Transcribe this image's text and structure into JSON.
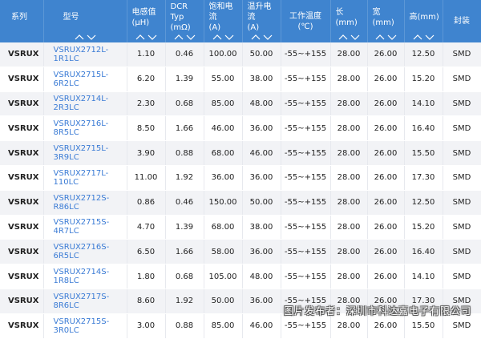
{
  "headers": {
    "series": "系列",
    "model": "型号",
    "inductance": "电感值\n(μH)",
    "dcr": "DCR Typ\n(mΩ)",
    "sat_current": "饱和电流\n(A)",
    "temp_current": "温升电流\n(A)",
    "op_temp": "工作温度\n(℃)",
    "length": "长(mm)",
    "width": "宽(mm)",
    "height": "高(mm)",
    "package": "封装"
  },
  "rows": [
    {
      "series": "VSRUX",
      "model": "VSRUX2712L-1R1LC",
      "inductance": "1.10",
      "dcr": "0.46",
      "sat": "100.00",
      "temp": "50.00",
      "op": "-55~+155",
      "l": "28.00",
      "w": "26.00",
      "h": "12.50",
      "pkg": "SMD"
    },
    {
      "series": "VSRUX",
      "model": "VSRUX2715L-6R2LC",
      "inductance": "6.20",
      "dcr": "1.39",
      "sat": "55.00",
      "temp": "38.00",
      "op": "-55~+155",
      "l": "28.00",
      "w": "26.00",
      "h": "15.20",
      "pkg": "SMD"
    },
    {
      "series": "VSRUX",
      "model": "VSRUX2714L-2R3LC",
      "inductance": "2.30",
      "dcr": "0.68",
      "sat": "85.00",
      "temp": "48.00",
      "op": "-55~+155",
      "l": "28.00",
      "w": "26.00",
      "h": "14.10",
      "pkg": "SMD"
    },
    {
      "series": "VSRUX",
      "model": "VSRUX2716L-8R5LC",
      "inductance": "8.50",
      "dcr": "1.66",
      "sat": "46.00",
      "temp": "36.00",
      "op": "-55~+155",
      "l": "28.00",
      "w": "26.00",
      "h": "16.40",
      "pkg": "SMD"
    },
    {
      "series": "VSRUX",
      "model": "VSRUX2715L-3R9LC",
      "inductance": "3.90",
      "dcr": "0.88",
      "sat": "68.00",
      "temp": "46.00",
      "op": "-55~+155",
      "l": "28.00",
      "w": "26.00",
      "h": "15.50",
      "pkg": "SMD"
    },
    {
      "series": "VSRUX",
      "model": "VSRUX2717L-110LC",
      "inductance": "11.00",
      "dcr": "1.92",
      "sat": "36.00",
      "temp": "36.00",
      "op": "-55~+155",
      "l": "28.00",
      "w": "26.00",
      "h": "17.30",
      "pkg": "SMD"
    },
    {
      "series": "VSRUX",
      "model": "VSRUX2712S-R86LC",
      "inductance": "0.86",
      "dcr": "0.46",
      "sat": "150.00",
      "temp": "50.00",
      "op": "-55~+155",
      "l": "28.00",
      "w": "26.00",
      "h": "12.50",
      "pkg": "SMD"
    },
    {
      "series": "VSRUX",
      "model": "VSRUX2715S-4R7LC",
      "inductance": "4.70",
      "dcr": "1.39",
      "sat": "68.00",
      "temp": "38.00",
      "op": "-55~+155",
      "l": "28.00",
      "w": "26.00",
      "h": "15.20",
      "pkg": "SMD"
    },
    {
      "series": "VSRUX",
      "model": "VSRUX2716S-6R5LC",
      "inductance": "6.50",
      "dcr": "1.66",
      "sat": "58.00",
      "temp": "36.00",
      "op": "-55~+155",
      "l": "28.00",
      "w": "26.00",
      "h": "16.40",
      "pkg": "SMD"
    },
    {
      "series": "VSRUX",
      "model": "VSRUX2714S-1R8LC",
      "inductance": "1.80",
      "dcr": "0.68",
      "sat": "105.00",
      "temp": "48.00",
      "op": "-55~+155",
      "l": "28.00",
      "w": "26.00",
      "h": "14.10",
      "pkg": "SMD"
    },
    {
      "series": "VSRUX",
      "model": "VSRUX2717S-8R6LC",
      "inductance": "8.60",
      "dcr": "1.92",
      "sat": "50.00",
      "temp": "36.00",
      "op": "-55~+155",
      "l": "28.00",
      "w": "26.00",
      "h": "17.30",
      "pkg": "SMD"
    },
    {
      "series": "VSRUX",
      "model": "VSRUX2715S-3R0LC",
      "inductance": "3.00",
      "dcr": "0.88",
      "sat": "85.00",
      "temp": "46.00",
      "op": "-55~+155",
      "l": "28.00",
      "w": "26.00",
      "h": "15.50",
      "pkg": "SMD"
    }
  ],
  "watermark": "图片发布者：深圳市科达嘉电子有限公司",
  "colors": {
    "header_bg": "#3f84cf",
    "link": "#3a7bd5",
    "row_alt": "#f2f3f6"
  }
}
